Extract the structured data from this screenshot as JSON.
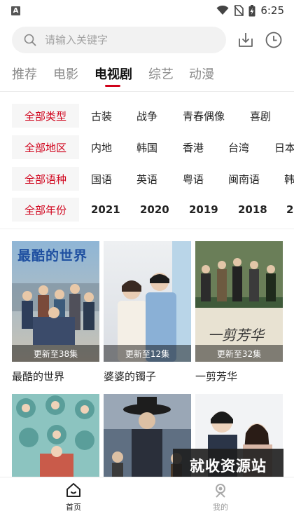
{
  "status_bar": {
    "time": "6:25",
    "notification_letter": "A",
    "battery_glyph": "⚡"
  },
  "search": {
    "placeholder": "请输入关键字"
  },
  "tabs": [
    {
      "label": "推荐",
      "active": false
    },
    {
      "label": "电影",
      "active": false
    },
    {
      "label": "电视剧",
      "active": true
    },
    {
      "label": "综艺",
      "active": false
    },
    {
      "label": "动漫",
      "active": false
    }
  ],
  "filters": {
    "type": {
      "label": "全部类型",
      "options": [
        "古装",
        "战争",
        "青春偶像",
        "喜剧"
      ]
    },
    "region": {
      "label": "全部地区",
      "options": [
        "内地",
        "韩国",
        "香港",
        "台湾",
        "日本"
      ]
    },
    "language": {
      "label": "全部语种",
      "options": [
        "国语",
        "英语",
        "粤语",
        "闽南语",
        "韩"
      ]
    },
    "year": {
      "label": "全部年份",
      "options": [
        "2021",
        "2020",
        "2019",
        "2018",
        "20"
      ]
    }
  },
  "shows": [
    {
      "title": "最酷的世界",
      "badge": "更新至38集",
      "poster_text": "最酷的世界"
    },
    {
      "title": "婆婆的镯子",
      "badge": "更新至12集",
      "poster_text": ""
    },
    {
      "title": "一剪芳华",
      "badge": "更新至32集",
      "poster_text": "一剪芳华"
    },
    {
      "title": "",
      "badge": "",
      "poster_text": ""
    },
    {
      "title": "",
      "badge": "",
      "poster_text": ""
    },
    {
      "title": "",
      "badge": "",
      "poster_text": ""
    }
  ],
  "watermark": "就收资源站",
  "bottom_nav": [
    {
      "label": "首页",
      "active": true
    },
    {
      "label": "我的",
      "active": false
    }
  ],
  "colors": {
    "accent": "#d0021b",
    "chip_bg": "#f6f6f6",
    "search_bg": "#f2f2f2"
  }
}
